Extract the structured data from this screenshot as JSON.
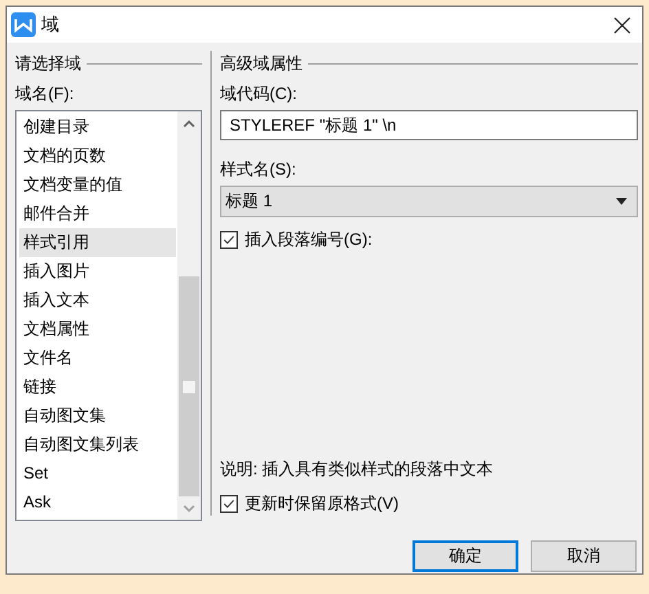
{
  "window": {
    "title": "域"
  },
  "left": {
    "heading": "请选择域",
    "list_label": "域名(F):",
    "items": [
      {
        "label": "创建目录",
        "selected": false
      },
      {
        "label": "文档的页数",
        "selected": false
      },
      {
        "label": "文档变量的值",
        "selected": false
      },
      {
        "label": "邮件合并",
        "selected": false
      },
      {
        "label": "样式引用",
        "selected": true
      },
      {
        "label": "插入图片",
        "selected": false
      },
      {
        "label": "插入文本",
        "selected": false
      },
      {
        "label": "文档属性",
        "selected": false
      },
      {
        "label": "文件名",
        "selected": false
      },
      {
        "label": "链接",
        "selected": false
      },
      {
        "label": "自动图文集",
        "selected": false
      },
      {
        "label": "自动图文集列表",
        "selected": false
      },
      {
        "label": "Set",
        "selected": false
      },
      {
        "label": "Ask",
        "selected": false
      }
    ]
  },
  "right": {
    "heading": "高级域属性",
    "code_label": "域代码(C):",
    "code_value": "STYLEREF \"标题 1\" \\n",
    "style_label": "样式名(S):",
    "style_value": "标题 1",
    "paragraph_number": {
      "label": "插入段落编号(G):",
      "checked": true
    },
    "description": "说明: 插入具有类似样式的段落中文本",
    "keep_format": {
      "label": "更新时保留原格式(V)",
      "checked": true
    }
  },
  "buttons": [
    {
      "label": "确定",
      "default": true
    },
    {
      "label": "取消",
      "default": false
    }
  ]
}
